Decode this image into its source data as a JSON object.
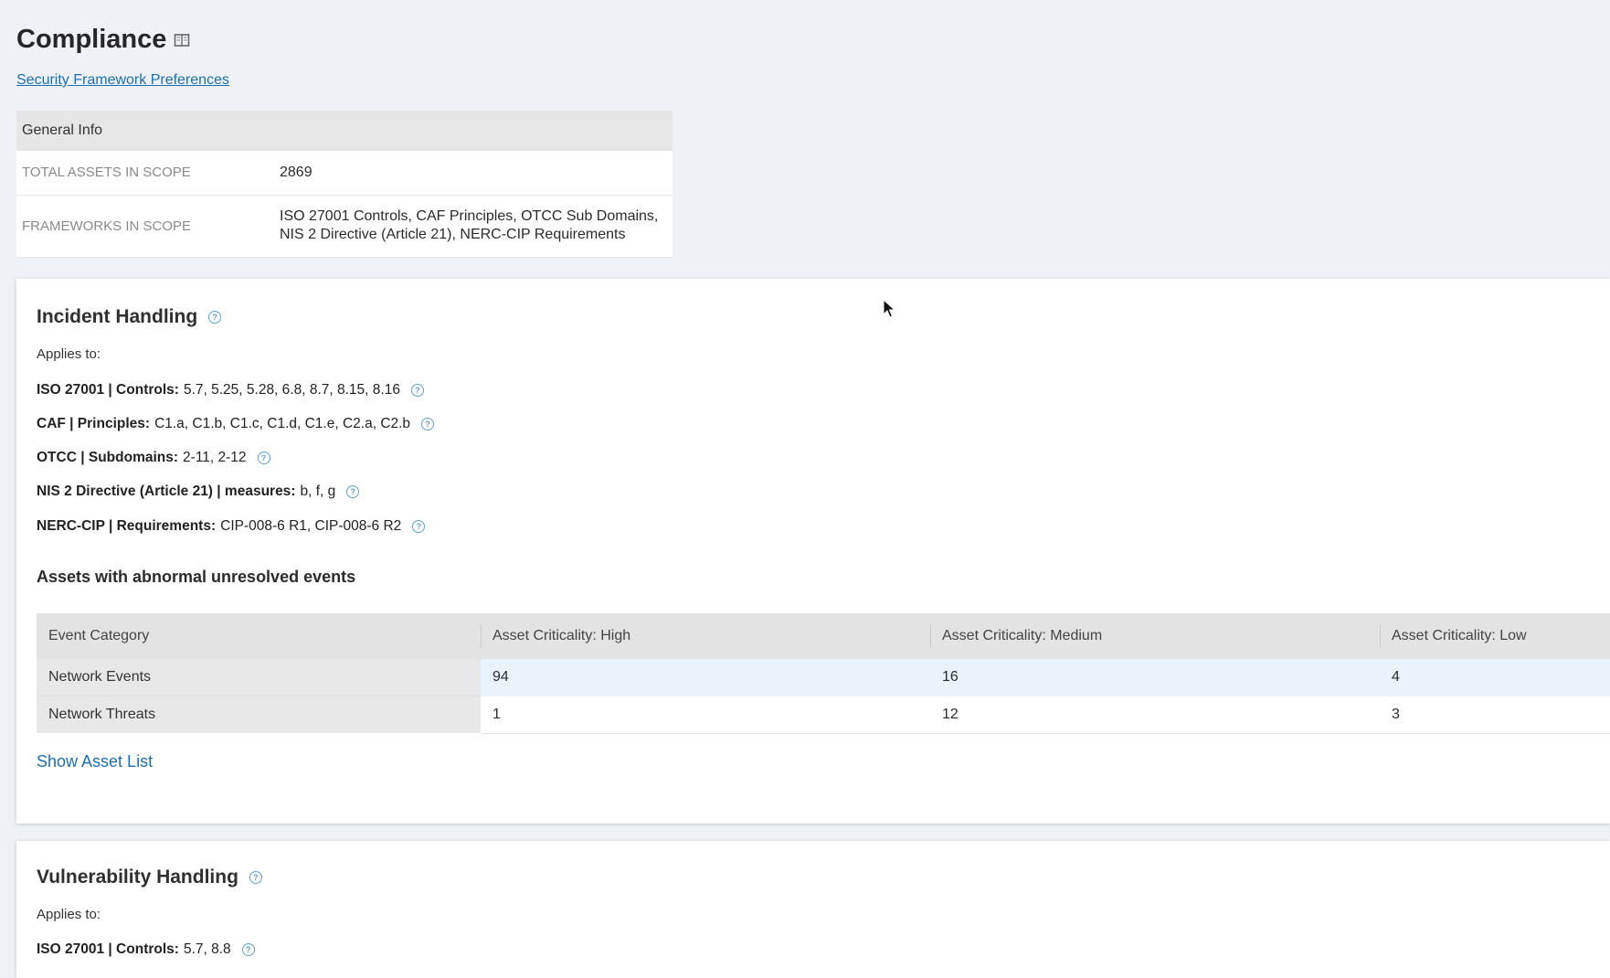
{
  "page": {
    "title": "Compliance",
    "title_icon": "book-icon",
    "preferences_link": "Security Framework Preferences"
  },
  "general_info": {
    "header": "General Info",
    "rows": [
      {
        "label": "TOTAL ASSETS IN SCOPE",
        "value": "2869"
      },
      {
        "label": "FRAMEWORKS IN SCOPE",
        "value_line1": "ISO 27001 Controls, CAF Principles, OTCC Sub Domains,",
        "value_line2": "NIS 2 Directive (Article 21), NERC-CIP Requirements"
      }
    ]
  },
  "incident_handling": {
    "title": "Incident Handling",
    "applies_to": "Applies to:",
    "frameworks": [
      {
        "label": "ISO 27001 | Controls:",
        "value": "5.7, 5.25, 5.28, 6.8, 8.7, 8.15, 8.16"
      },
      {
        "label": "CAF | Principles:",
        "value": "C1.a, C1.b, C1.c, C1.d, C1.e, C2.a, C2.b"
      },
      {
        "label": "OTCC | Subdomains:",
        "value": "2-11, 2-12"
      },
      {
        "label": "NIS 2 Directive (Article 21) | measures:",
        "value": "b, f, g"
      },
      {
        "label": "NERC-CIP | Requirements:",
        "value": "CIP-008-6 R1, CIP-008-6 R2"
      }
    ],
    "assets_heading": "Assets with abnormal unresolved events",
    "table": {
      "headers": [
        "Event Category",
        "Asset Criticality: High",
        "Asset Criticality: Medium",
        "Asset Criticality: Low"
      ],
      "rows": [
        {
          "category": "Network Events",
          "high": "94",
          "medium": "16",
          "low": "4"
        },
        {
          "category": "Network Threats",
          "high": "1",
          "medium": "12",
          "low": "3"
        }
      ]
    },
    "show_asset_list": "Show Asset List"
  },
  "vulnerability_handling": {
    "title": "Vulnerability Handling",
    "applies_to": "Applies to:",
    "frameworks": [
      {
        "label": "ISO 27001 | Controls:",
        "value": "5.7, 8.8"
      }
    ]
  },
  "colors": {
    "page_bg": "#eef2f7",
    "link": "#1b6fb0",
    "help_icon": "#5e9fd3",
    "highlight_row": "#e9f3fb"
  }
}
